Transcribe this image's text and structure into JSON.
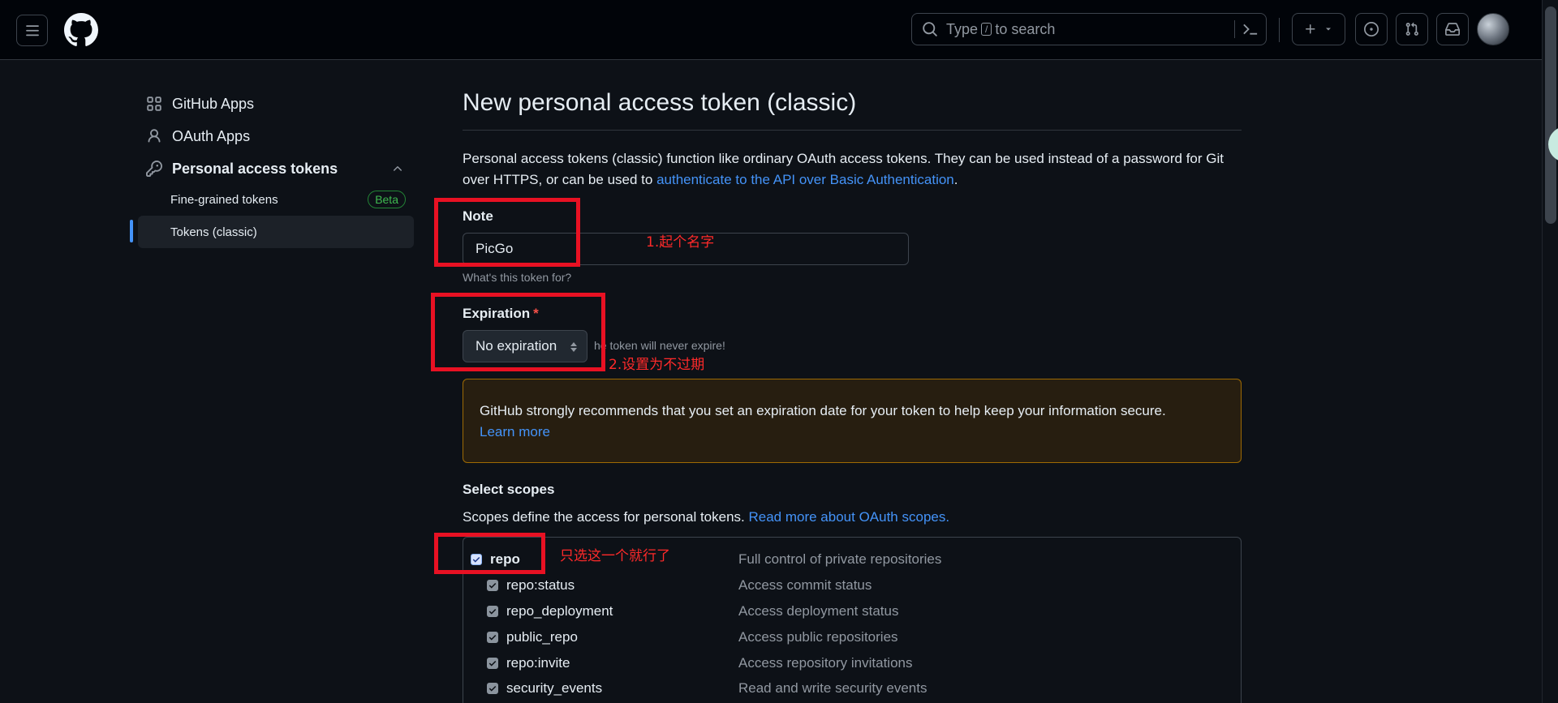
{
  "header": {
    "search_placeholder_pre": "Type",
    "search_key": "/",
    "search_placeholder_post": "to search"
  },
  "sidebar": {
    "items": [
      {
        "label": "GitHub Apps",
        "icon": "apps-grid-icon"
      },
      {
        "label": "OAuth Apps",
        "icon": "person-icon"
      },
      {
        "label": "Personal access tokens",
        "icon": "key-icon"
      }
    ],
    "sub_items": [
      {
        "label": "Fine-grained tokens",
        "badge": "Beta"
      },
      {
        "label": "Tokens (classic)"
      }
    ]
  },
  "main": {
    "title": "New personal access token (classic)",
    "intro_text": "Personal access tokens (classic) function like ordinary OAuth access tokens. They can be used instead of a password for Git over HTTPS, or can be used to ",
    "intro_link": "authenticate to the API over Basic Authentication",
    "intro_end": ".",
    "note": {
      "label": "Note",
      "value": "PicGo",
      "help": "What's this token for?"
    },
    "expiration": {
      "label": "Expiration",
      "required_mark": "*",
      "selected": "No expiration",
      "help": "he token will never expire!"
    },
    "warning": {
      "text": "GitHub strongly recommends that you set an expiration date for your token to help keep your information secure.",
      "link": "Learn more"
    },
    "scopes": {
      "title": "Select scopes",
      "desc": "Scopes define the access for personal tokens. ",
      "desc_link": "Read more about OAuth scopes.",
      "rows": [
        {
          "name": "repo",
          "desc": "Full control of private repositories",
          "checked": true
        },
        {
          "name": "repo:status",
          "desc": "Access commit status",
          "checked": true
        },
        {
          "name": "repo_deployment",
          "desc": "Access deployment status",
          "checked": true
        },
        {
          "name": "public_repo",
          "desc": "Access public repositories",
          "checked": true
        },
        {
          "name": "repo:invite",
          "desc": "Access repository invitations",
          "checked": true
        },
        {
          "name": "security_events",
          "desc": "Read and write security events",
          "checked": true
        }
      ]
    }
  },
  "annotations": {
    "note": "1.起个名字",
    "expiration": "2.设置为不过期",
    "repo": "只选这一个就行了"
  },
  "colors": {
    "annotation_red": "#e81123",
    "accent": "#4493f8",
    "success": "#3fb950"
  }
}
